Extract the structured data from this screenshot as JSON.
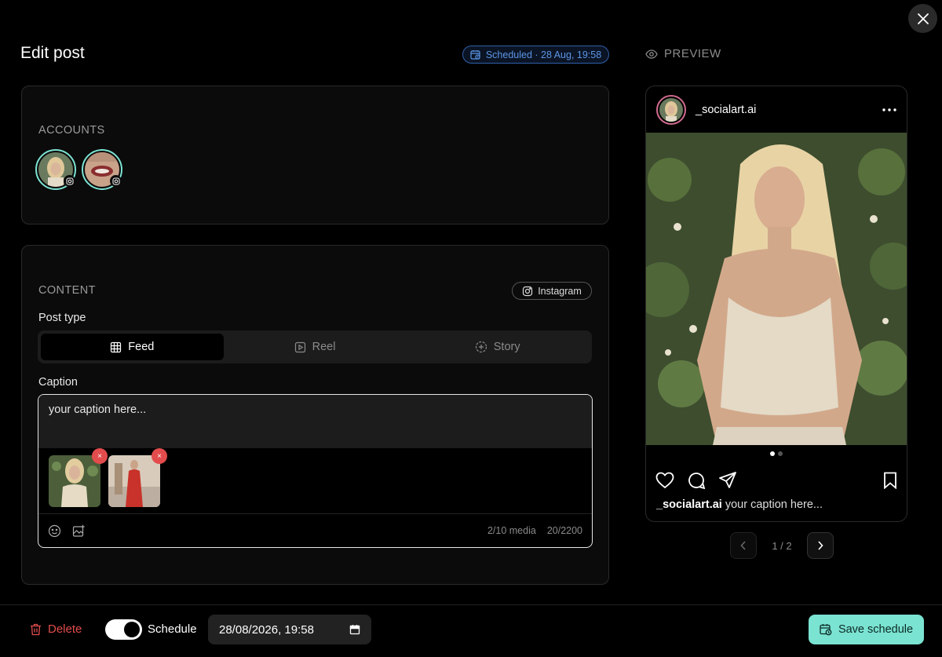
{
  "header": {
    "title": "Edit post",
    "schedule_badge": "Scheduled · 28 Aug, 19:58",
    "close_icon": "close-icon",
    "preview_label": "PREVIEW",
    "preview_icon": "eye-icon"
  },
  "accounts": {
    "label": "ACCOUNTS",
    "items": [
      {
        "name": "account-1",
        "platform_icon": "instagram-icon",
        "selected": true
      },
      {
        "name": "account-2",
        "platform_icon": "instagram-icon",
        "selected": true
      }
    ]
  },
  "content": {
    "label": "CONTENT",
    "platform_chip": "Instagram",
    "post_type_label": "Post type",
    "post_types": [
      {
        "label": "Feed",
        "icon": "grid-icon",
        "active": true
      },
      {
        "label": "Reel",
        "icon": "play-icon",
        "active": false
      },
      {
        "label": "Story",
        "icon": "story-icon",
        "active": false
      }
    ],
    "caption_label": "Caption",
    "caption_value": "your caption here...",
    "media_count": "2/10 media",
    "char_count": "20/2200",
    "remove_glyph": "×"
  },
  "preview": {
    "username": "_socialart.ai",
    "caption_user": "_socialart.ai",
    "caption_text": "your caption here...",
    "page_indicator": "1 / 2",
    "more_icon": "more-dots-icon"
  },
  "footer": {
    "delete_label": "Delete",
    "schedule_label": "Schedule",
    "schedule_enabled": true,
    "datetime_value": "28/08/2026, 19:58",
    "save_label": "Save schedule"
  },
  "colors": {
    "accent": "#7be3d2",
    "danger": "#e24c4c",
    "badge_blue": "#5b95e6",
    "background": "#000000"
  }
}
